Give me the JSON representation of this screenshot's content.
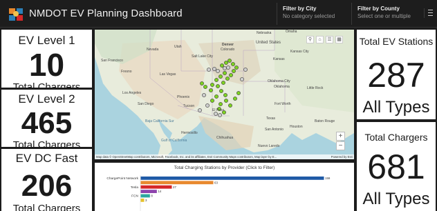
{
  "header": {
    "title": "NMDOT EV Planning Dashboard",
    "filters": [
      {
        "label": "Filter by City",
        "value": "No category selected"
      },
      {
        "label": "Filter by County",
        "value": "Select one or multiple"
      }
    ],
    "menu_icon": "hamburger-menu-icon",
    "logo_icon": "dashboard-logo-icon"
  },
  "indicators": {
    "ev_level1": {
      "title": "EV Level 1",
      "value": "10",
      "subtitle": "Total Chargers"
    },
    "ev_level2": {
      "title": "EV Level 2",
      "value": "465",
      "subtitle": "Total Chargers"
    },
    "ev_dc_fast": {
      "title": "EV DC Fast",
      "value": "206",
      "subtitle": "Total Chargers"
    },
    "total_stations": {
      "title": "Total EV Stations",
      "value": "287",
      "subtitle": "All Types"
    },
    "total_chargers": {
      "title": "Total Chargers",
      "value": "681",
      "subtitle": "All Types"
    }
  },
  "map": {
    "labels": {
      "salt_lake_city": "Salt Lake City",
      "nevada": "Nevada",
      "utah": "Utah",
      "denver": "Denver",
      "colorado": "Colorado",
      "nebraska": "Nebraska",
      "united_states": "United States",
      "kansas_city": "Kansas City",
      "kansas": "Kansas",
      "san_francisco": "San Francisco",
      "fresno": "Fresno",
      "las_vegas": "Las Vegas",
      "los_angeles": "Los Angeles",
      "san_diego": "San Diego",
      "phoenix": "Phoenix",
      "tucson": "Tucson",
      "el_paso": "El Paso",
      "oklahoma_city": "Oklahoma City",
      "oklahoma": "Oklahoma",
      "little_rock": "Little Rock",
      "fort_worth": "Fort Worth",
      "texas": "Texas",
      "san_antonio": "San Antonio",
      "houston": "Houston",
      "baton_rouge": "Baton Rouge",
      "hermosillo": "Hermosillo",
      "chihuahua": "Chihuahua",
      "baja_california": "Baja California Sur",
      "gulf_california": "Gulf of California",
      "nuevo_laredo": "Nuevo Laredo",
      "omaha": "Omaha"
    },
    "attribution": "Map data © OpenStreetMap contributors, Microsoft, Facebook, Inc. and its affiliates, Esri Community Maps contributors, Map layer by E...",
    "powered_by": "Powered by Esri",
    "tools": [
      "search-icon",
      "home-icon",
      "layers-icon",
      "basemap-gallery-icon"
    ],
    "zoom_in": "+",
    "zoom_out": "−"
  },
  "chart_data": {
    "type": "bar",
    "orientation": "horizontal",
    "title": "Total Charging Stations by Provider (Click to Filter)",
    "categories": [
      "ChargePoint Network",
      "",
      "Tesla",
      "",
      "FCN",
      ""
    ],
    "series": [
      {
        "color": "#1f5aa6",
        "values": [
          159,
          0,
          0,
          0,
          0,
          0
        ]
      },
      {
        "color": "#e8892e",
        "values": [
          0,
          63,
          0,
          0,
          0,
          0
        ]
      },
      {
        "color": "#d62728",
        "values": [
          0,
          0,
          27,
          0,
          0,
          0
        ]
      },
      {
        "color": "#8e44ad",
        "values": [
          0,
          0,
          0,
          14,
          0,
          0
        ]
      },
      {
        "color": "#2ca7a0",
        "values": [
          0,
          0,
          0,
          0,
          8,
          0
        ]
      },
      {
        "color": "#e6c229",
        "values": [
          0,
          0,
          0,
          0,
          0,
          3
        ]
      }
    ],
    "data_labels": [
      "159",
      "63",
      "27",
      "14",
      "8",
      "3"
    ],
    "xlim": [
      0,
      180
    ]
  }
}
